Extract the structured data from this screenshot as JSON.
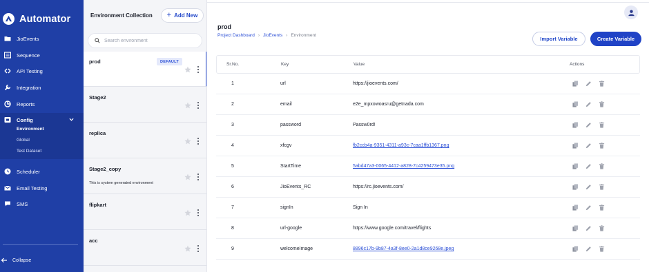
{
  "app": {
    "name": "Automator"
  },
  "sidebar": {
    "items": [
      {
        "label": "JioEvents",
        "icon": "folder-icon"
      },
      {
        "label": "Sequence",
        "icon": "list-icon"
      },
      {
        "label": "API Testing",
        "icon": "api-icon"
      },
      {
        "label": "Integration",
        "icon": "wrench-icon"
      },
      {
        "label": "Reports",
        "icon": "report-icon"
      }
    ],
    "config": {
      "label": "Config",
      "expanded": true,
      "children": [
        {
          "label": "Environment",
          "active": true
        },
        {
          "label": "Global",
          "active": false
        },
        {
          "label": "Test Dataset",
          "active": false
        }
      ]
    },
    "items_bottom": [
      {
        "label": "Scheduler",
        "icon": "clock-icon"
      },
      {
        "label": "Email Testing",
        "icon": "mail-icon"
      },
      {
        "label": "SMS",
        "icon": "chat-icon"
      }
    ],
    "collapse_label": "Collapse",
    "colors": {
      "background": "#1f3fa6",
      "config_background": "#1b3794"
    }
  },
  "env_panel": {
    "title": "Environment Collection",
    "add_label": "Add New",
    "search_placeholder": "Search environment",
    "environments": [
      {
        "name": "prod",
        "badge": "DEFAULT",
        "description": "",
        "active": true
      },
      {
        "name": "Stage2",
        "badge": "",
        "description": "",
        "active": false
      },
      {
        "name": "replica",
        "badge": "",
        "description": "",
        "active": false
      },
      {
        "name": "Stage2_copy",
        "badge": "",
        "description": "This is system generated environment",
        "active": false
      },
      {
        "name": "flipkart",
        "badge": "",
        "description": "",
        "active": false
      },
      {
        "name": "acc",
        "badge": "",
        "description": "",
        "active": false
      }
    ]
  },
  "main": {
    "title": "prod",
    "breadcrumb": {
      "items": [
        "Project Dashboard",
        "JioEvents"
      ],
      "current": "Environment"
    },
    "import_label": "Import Variable",
    "create_label": "Create Variable",
    "accent": "#2043c6",
    "table": {
      "columns": [
        "Sr.No.",
        "Key",
        "Value",
        "Actions"
      ],
      "rows": [
        {
          "sr": "1",
          "key": "url",
          "value": "https://jioevents.com/",
          "is_file": false
        },
        {
          "sr": "2",
          "key": "email",
          "value": "e2e_mpxowoasru@getnada.com",
          "is_file": false
        },
        {
          "sr": "3",
          "key": "password",
          "value": "Passw0rd!",
          "is_file": false
        },
        {
          "sr": "4",
          "key": "xfcgv",
          "value": "fb2ccb4a-9351-4311-a93c-7caa1ffb1367.png",
          "is_file": true
        },
        {
          "sr": "5",
          "key": "StartTime",
          "value": "5abd47a3-0065-4412-a828-7c4259473e35.png",
          "is_file": true
        },
        {
          "sr": "6",
          "key": "JioEvents_RC",
          "value": "https://rc.jioevents.com/",
          "is_file": false
        },
        {
          "sr": "7",
          "key": "signIn",
          "value": "Sign In",
          "is_file": false
        },
        {
          "sr": "8",
          "key": "url-google",
          "value": "https://www.google.com/travel/flights",
          "is_file": false
        },
        {
          "sr": "9",
          "key": "welcomeImage",
          "value": "8896c17b-9b87-4a3f-8ee0-2a1d8ce9268e.jpeg",
          "is_file": true
        }
      ]
    }
  }
}
